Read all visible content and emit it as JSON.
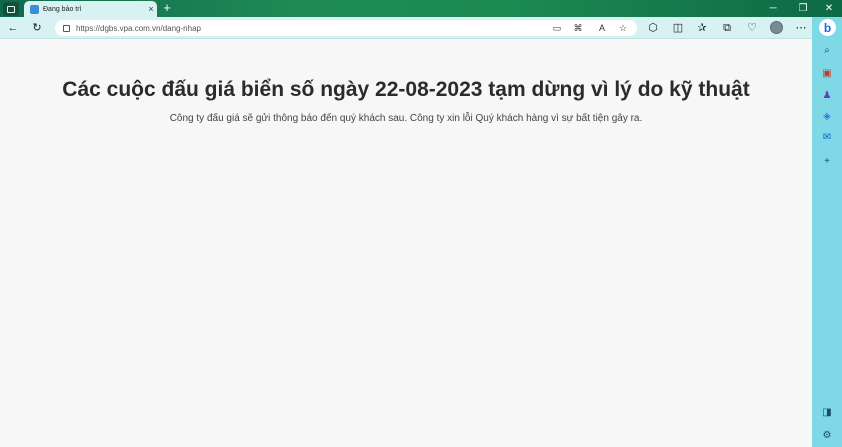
{
  "browser": {
    "tab": {
      "title": "Đang bảo trì",
      "close": "×"
    },
    "new_tab": "+",
    "window_controls": {
      "minimize": "─",
      "restore": "❐",
      "close": "✕"
    },
    "address_bar": {
      "url": "https://dgbs.vpa.com.vn/dang-nhap"
    },
    "sidebar": {
      "bing_label": "b"
    }
  },
  "page": {
    "headline": "Các cuộc đấu giá biển số ngày 22-08-2023 tạm dừng vì lý do kỹ thuật",
    "message": "Công ty đấu giá sẽ gửi thông báo đến quý khách sau. Công ty xin lỗi Quý khách hàng vì sự bất tiện gây ra."
  }
}
